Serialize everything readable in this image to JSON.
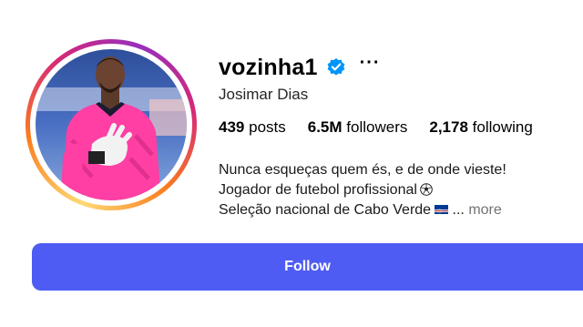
{
  "profile": {
    "username": "vozinha1",
    "full_name": "Josimar Dias",
    "verified_icon": "verified-badge-icon",
    "more_icon": "more-options-icon",
    "more_label": "···",
    "stats": {
      "posts_count": "439",
      "posts_label": "posts",
      "followers_count": "6.5M",
      "followers_label": "followers",
      "following_count": "2,178",
      "following_label": "following"
    },
    "bio": {
      "line1": "Nunca esqueças quem és, e de onde vieste!",
      "line2": "Jogador de futebol profissional",
      "line3": "Seleção nacional de Cabo Verde",
      "line3_ellipsis": "...",
      "more_label": "more"
    },
    "follow_label": "Follow"
  },
  "colors": {
    "follow_button": "#4f5cf4",
    "verified": "#0095f6",
    "muted_text": "#737373",
    "jersey": "#ff3fa4"
  }
}
